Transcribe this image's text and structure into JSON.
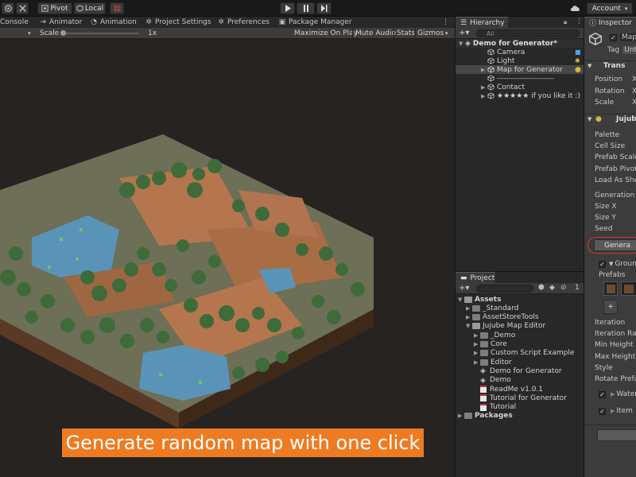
{
  "toolbar": {
    "pivot_label": "Pivot",
    "local_label": "Local",
    "account_label": "Account"
  },
  "tabs": [
    {
      "label": "Console",
      "icon": "console-icon"
    },
    {
      "label": "Animator",
      "icon": "animator-icon"
    },
    {
      "label": "Animation",
      "icon": "animation-icon"
    },
    {
      "label": "Project Settings",
      "icon": "gear-icon"
    },
    {
      "label": "Preferences",
      "icon": "gear-icon"
    },
    {
      "label": "Package Manager",
      "icon": "package-icon"
    }
  ],
  "gamebar": {
    "scale_label": "Scale",
    "scale_value": "1x",
    "maximize": "Maximize On Play",
    "mute": "Mute Audio",
    "stats": "Stats",
    "gizmos": "Gizmos"
  },
  "caption": "Generate random map with one click",
  "hierarchy": {
    "tab": "Hierarchy",
    "search_placeholder": "All",
    "scene": "Demo for Generator*",
    "items": [
      "Camera",
      "Light",
      "Map for Generator",
      "-------------------------",
      "Contact",
      "★★★★★ if you like it :)"
    ]
  },
  "project": {
    "tab": "Project",
    "count": "1",
    "rows": [
      {
        "label": "Assets",
        "indent": 0,
        "kind": "folder-open",
        "bold": true
      },
      {
        "label": "_Standard",
        "indent": 1,
        "kind": "folder"
      },
      {
        "label": "AssetStoreTools",
        "indent": 1,
        "kind": "folder"
      },
      {
        "label": "Jujube Map Editor",
        "indent": 1,
        "kind": "folder-open"
      },
      {
        "label": "_Demo",
        "indent": 2,
        "kind": "folder"
      },
      {
        "label": "Core",
        "indent": 2,
        "kind": "folder"
      },
      {
        "label": "Custom Script Example",
        "indent": 2,
        "kind": "folder"
      },
      {
        "label": "Editor",
        "indent": 2,
        "kind": "folder"
      },
      {
        "label": "Demo for Generator",
        "indent": 2,
        "kind": "scene"
      },
      {
        "label": "Demo",
        "indent": 2,
        "kind": "scene"
      },
      {
        "label": "ReadMe v1.0.1",
        "indent": 2,
        "kind": "pdf"
      },
      {
        "label": "Tutorial for Generator",
        "indent": 2,
        "kind": "pdf"
      },
      {
        "label": "Tutorial",
        "indent": 2,
        "kind": "pdf"
      },
      {
        "label": "Packages",
        "indent": 0,
        "kind": "folder",
        "bold": true
      }
    ]
  },
  "inspector": {
    "tab": "Inspector",
    "object_name": "Map",
    "tag_label": "Tag",
    "tag_value": "Unta",
    "transform_header": "Trans",
    "transform_rows": [
      "Position",
      "Rotation",
      "Scale"
    ],
    "axis_label": "X",
    "component_header": "Jujube",
    "fields": [
      "Palette",
      "Cell Size",
      "Prefab Scale",
      "Prefab Pivot",
      "Load As Shell"
    ],
    "generation_label": "Generation",
    "gen_fields": [
      "Size X",
      "Size Y",
      "Seed"
    ],
    "generate_button": "Genera",
    "ground_label": "Groun",
    "prefabs_label": "Prefabs",
    "add_symbol": "+",
    "more_fields": [
      "Iteration",
      "Iteration Rad",
      "Min Height",
      "Max Height",
      "Style",
      "Rotate Prefa"
    ],
    "water_label": "Water",
    "item_label": "Item"
  },
  "colors": {
    "caption_bg": "#ee7b22",
    "water": "#5a93b8",
    "dirt": "#b5764d",
    "grass": "#6a7058",
    "tree": "#3f6b3a"
  }
}
